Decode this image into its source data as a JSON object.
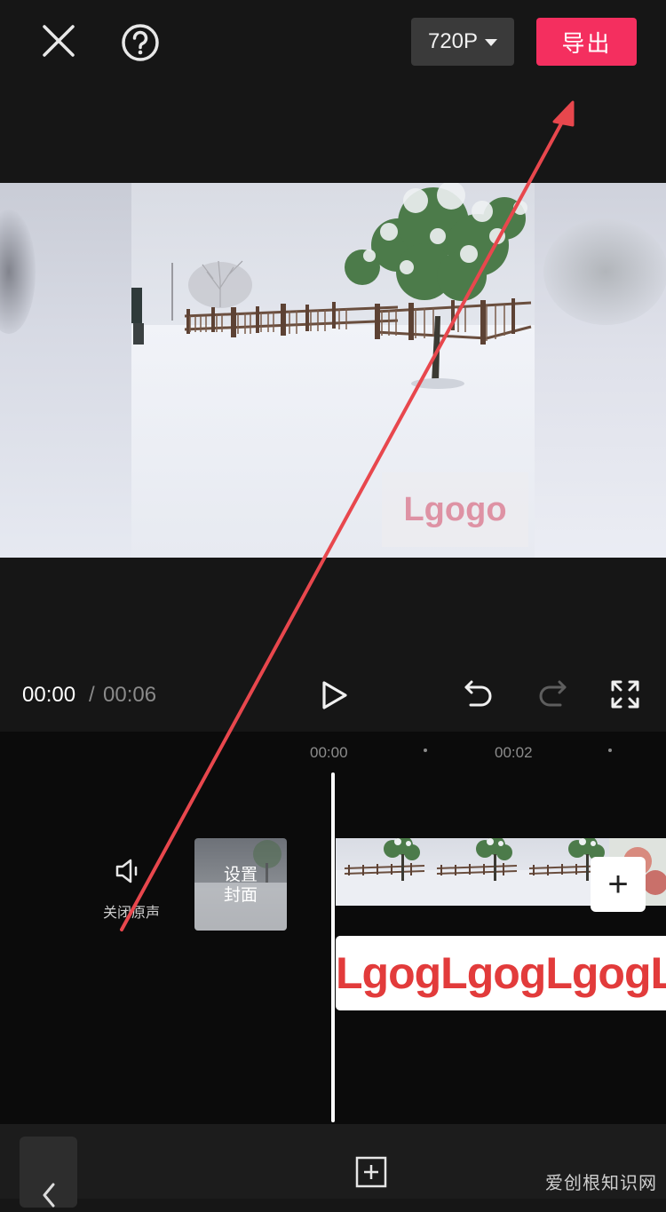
{
  "topbar": {
    "close_icon": "close-icon",
    "help_icon": "help-icon",
    "resolution_label": "720P",
    "export_label": "导出",
    "accent_color": "#f42f5f"
  },
  "preview": {
    "watermark_text": "Lgogo"
  },
  "playback": {
    "current_time": "00:00",
    "separator": "/",
    "total_time": "00:06",
    "play_icon": "play-icon",
    "undo_icon": "undo-icon",
    "redo_icon": "redo-icon",
    "fullscreen_icon": "fullscreen-icon"
  },
  "timeline": {
    "ticks": [
      "00:00",
      "00:02"
    ],
    "mute_label": "关闭原声",
    "cover_label_line1": "设置",
    "cover_label_line2": "封面",
    "watermark_track_text": "LgogLgogLgogLgo",
    "add_clip_label": "+"
  },
  "bottombar": {
    "back_label": "‹",
    "site_watermark": "爱创根知识网"
  }
}
